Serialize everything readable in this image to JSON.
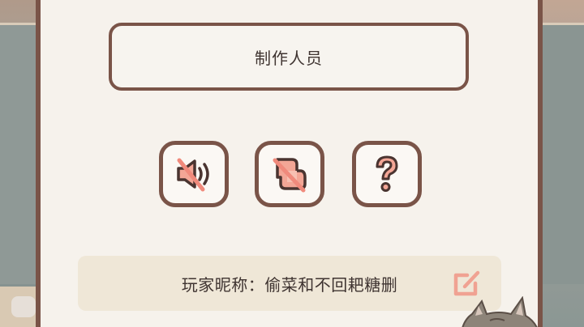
{
  "settings": {
    "credits_button_label": "制作人员",
    "nickname_label": "玩家昵称：",
    "nickname_value": "偷菜和不回耙糖删"
  },
  "icons": {
    "sound": "speaker-muted-icon",
    "music": "music-note-muted-icon",
    "help": "question-mark-icon",
    "edit": "edit-pencil-icon"
  },
  "colors": {
    "panel_border": "#7a5448",
    "panel_background": "#f6f2ec",
    "icon_accent": "#f09a8c",
    "text": "#3f3431",
    "nickname_bar": "#efe7d7"
  }
}
